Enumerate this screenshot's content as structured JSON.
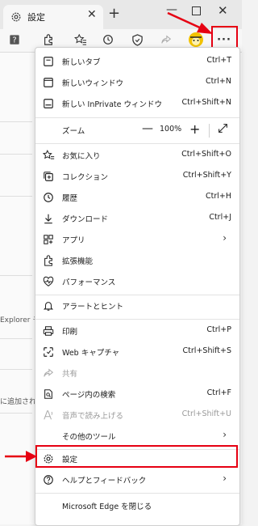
{
  "browser": {
    "tab_title": "設定",
    "tab_close_glyph": "✕",
    "new_tab_glyph": "+",
    "window": {
      "minimize_glyph": "—",
      "close_glyph": "✕"
    },
    "toolbar": {
      "icons": [
        "help-icon",
        "extensions-icon",
        "favorites-icon",
        "history-icon",
        "shield-icon",
        "share-icon",
        "profile-icon",
        "more-icon"
      ],
      "more_glyph": "···"
    }
  },
  "background_page": {
    "text1": "Explorer モ",
    "text2": "に追加され"
  },
  "menu": {
    "items": [
      {
        "label": "新しいタブ",
        "shortcut": "Ctrl+T",
        "icon": "new-tab-icon"
      },
      {
        "label": "新しいウィンドウ",
        "shortcut": "Ctrl+N",
        "icon": "new-window-icon"
      },
      {
        "label": "新しい InPrivate ウィンドウ",
        "shortcut": "Ctrl+Shift+N",
        "icon": "inprivate-icon"
      },
      {
        "label": "お気に入り",
        "shortcut": "Ctrl+Shift+O",
        "icon": "favorites-icon"
      },
      {
        "label": "コレクション",
        "shortcut": "Ctrl+Shift+Y",
        "icon": "collections-icon"
      },
      {
        "label": "履歴",
        "shortcut": "Ctrl+H",
        "icon": "history-icon"
      },
      {
        "label": "ダウンロード",
        "shortcut": "Ctrl+J",
        "icon": "download-icon"
      },
      {
        "label": "アプリ",
        "shortcut": "",
        "icon": "apps-icon"
      },
      {
        "label": "拡張機能",
        "shortcut": "",
        "icon": "extensions-icon"
      },
      {
        "label": "パフォーマンス",
        "shortcut": "",
        "icon": "performance-icon"
      },
      {
        "label": "アラートとヒント",
        "shortcut": "",
        "icon": "bell-icon"
      },
      {
        "label": "印刷",
        "shortcut": "Ctrl+P",
        "icon": "print-icon"
      },
      {
        "label": "Web キャプチャ",
        "shortcut": "Ctrl+Shift+S",
        "icon": "web-capture-icon"
      },
      {
        "label": "共有",
        "shortcut": "",
        "icon": "share-icon"
      },
      {
        "label": "ページ内の検索",
        "shortcut": "Ctrl+F",
        "icon": "find-icon"
      },
      {
        "label": "音声で読み上げる",
        "shortcut": "Ctrl+Shift+U",
        "icon": "read-aloud-icon"
      },
      {
        "label": "その他のツール",
        "shortcut": "",
        "icon": ""
      },
      {
        "label": "設定",
        "shortcut": "",
        "icon": "gear-icon"
      },
      {
        "label": "ヘルプとフィードバック",
        "shortcut": "",
        "icon": "help-icon"
      },
      {
        "label": "Microsoft Edge を閉じる",
        "shortcut": "",
        "icon": ""
      }
    ],
    "zoom": {
      "label": "ズーム",
      "value": "100%",
      "minus": "—",
      "plus": "+"
    }
  },
  "colors": {
    "highlight": "#e60012",
    "menu_bg": "#ffffff"
  }
}
